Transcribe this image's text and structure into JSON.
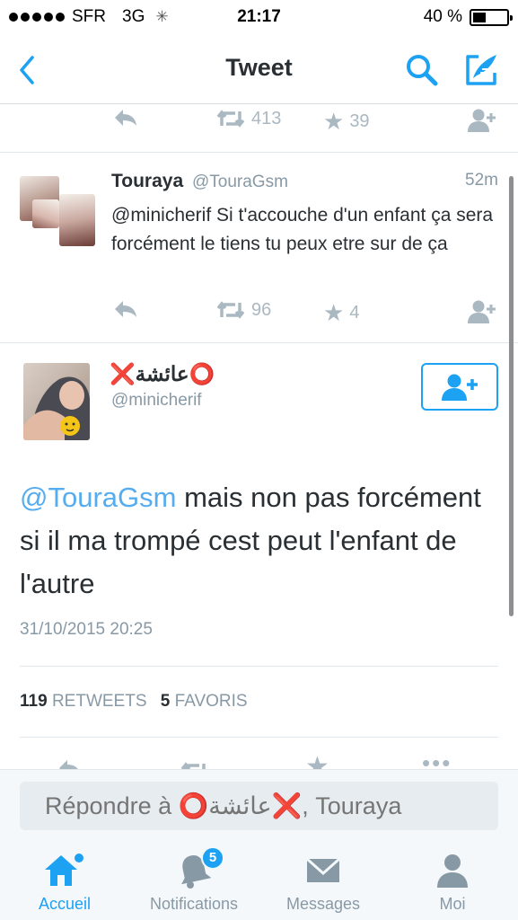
{
  "status_bar": {
    "carrier": "SFR",
    "network": "3G",
    "time": "21:17",
    "battery_percent": "40 %",
    "battery_level": 0.4
  },
  "nav": {
    "title": "Tweet",
    "back_icon": "chevron-left-icon",
    "search_icon": "search-icon",
    "compose_icon": "compose-icon"
  },
  "top_partial_tweet": {
    "retweets": "413",
    "favorites": "39"
  },
  "reply_tweet": {
    "name": "Touraya",
    "handle": "@TouraGsm",
    "time": "52m",
    "text": "@minicherif Si t'accouche d'un enfant ça sera forcément le tiens tu peux etre sur de ça",
    "retweets": "96",
    "favorites": "4"
  },
  "main_tweet": {
    "name": "❌عائشة⭕",
    "handle": "@minicherif",
    "mention": "@TouraGsm",
    "text": " mais non pas forcément si il ma trompé cest peut l'enfant de l'autre",
    "date": "31/10/2015 20:25",
    "retweets_count": "119",
    "retweets_label": "RETWEETS",
    "favorites_count": "5",
    "favorites_label": "FAVORIS"
  },
  "reply_bar": {
    "placeholder": "Répondre à ⭕عائشة❌, Touraya"
  },
  "tabs": [
    {
      "label": "Accueil",
      "icon": "home-icon",
      "active": true
    },
    {
      "label": "Notifications",
      "icon": "bell-icon",
      "badge": "5"
    },
    {
      "label": "Messages",
      "icon": "envelope-icon"
    },
    {
      "label": "Moi",
      "icon": "person-icon"
    }
  ],
  "colors": {
    "accent": "#1da1f2",
    "mention": "#55acee",
    "muted": "#8899a6",
    "action_gray": "#aab8c2"
  }
}
